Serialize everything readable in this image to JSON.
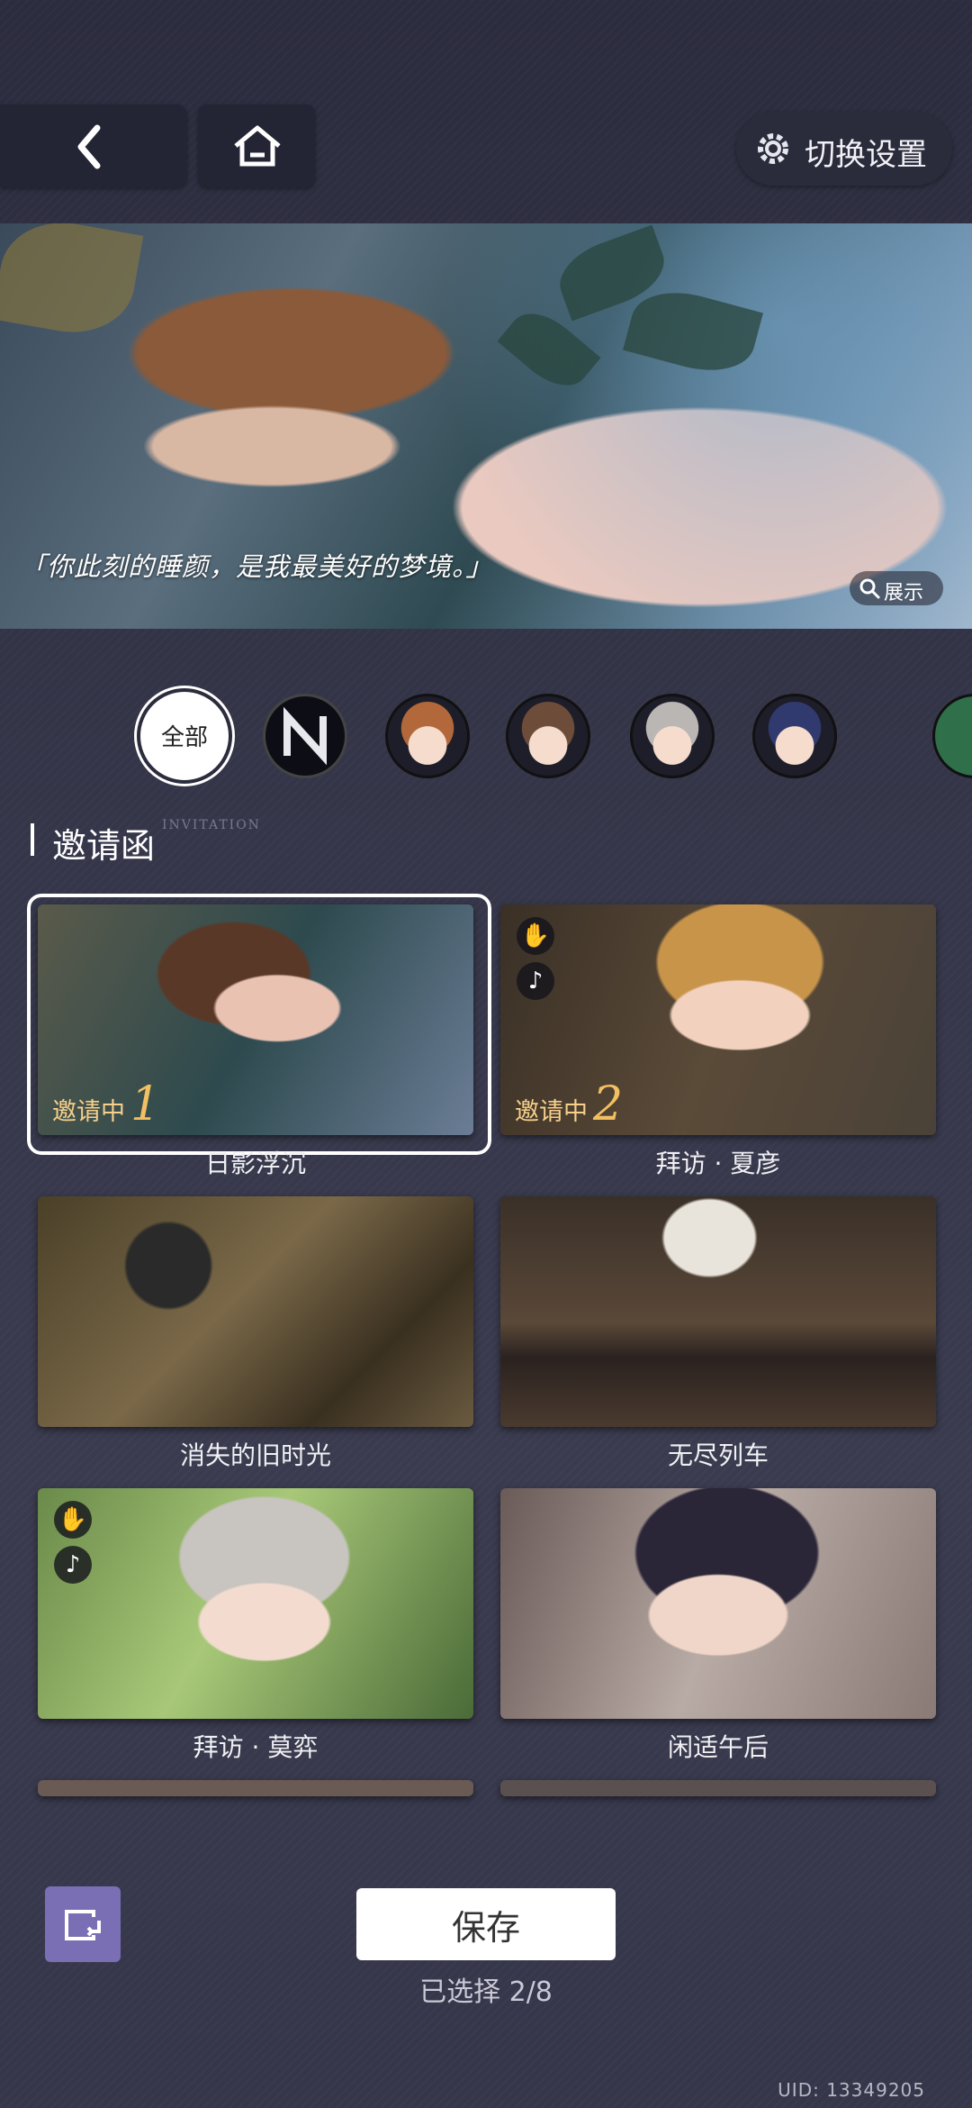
{
  "header": {
    "settings_label": "切换设置"
  },
  "banner": {
    "quote": "「你此刻的睡颜，是我最美好的梦境。」",
    "show_label": "展示"
  },
  "filters": {
    "all_label": "全部",
    "avatars": [
      "logo-n-icon",
      "avatar-xia-yan",
      "avatar-bai-qi",
      "avatar-mo-yi",
      "avatar-zhou-qiluo",
      "avatar-partial"
    ]
  },
  "section": {
    "title": "邀请函",
    "subtitle": "INVITATION"
  },
  "cards": [
    {
      "label": "日影浮沉",
      "badge_text": "邀请中",
      "badge_num": "1",
      "selected": true
    },
    {
      "label": "拜访 · 夏彦",
      "badge_text": "邀请中",
      "badge_num": "2",
      "selected": true
    },
    {
      "label": "消失的旧时光"
    },
    {
      "label": "无尽列车"
    },
    {
      "label": "拜访 · 莫弈"
    },
    {
      "label": "闲适午后"
    }
  ],
  "footer": {
    "save_label": "保存",
    "selected_count": "已选择 2/8",
    "uid": "UID: 13349205"
  },
  "colors": {
    "background": "#35364a",
    "accent_gold": "#f2c062",
    "rotate_button": "#7a6fb5"
  }
}
